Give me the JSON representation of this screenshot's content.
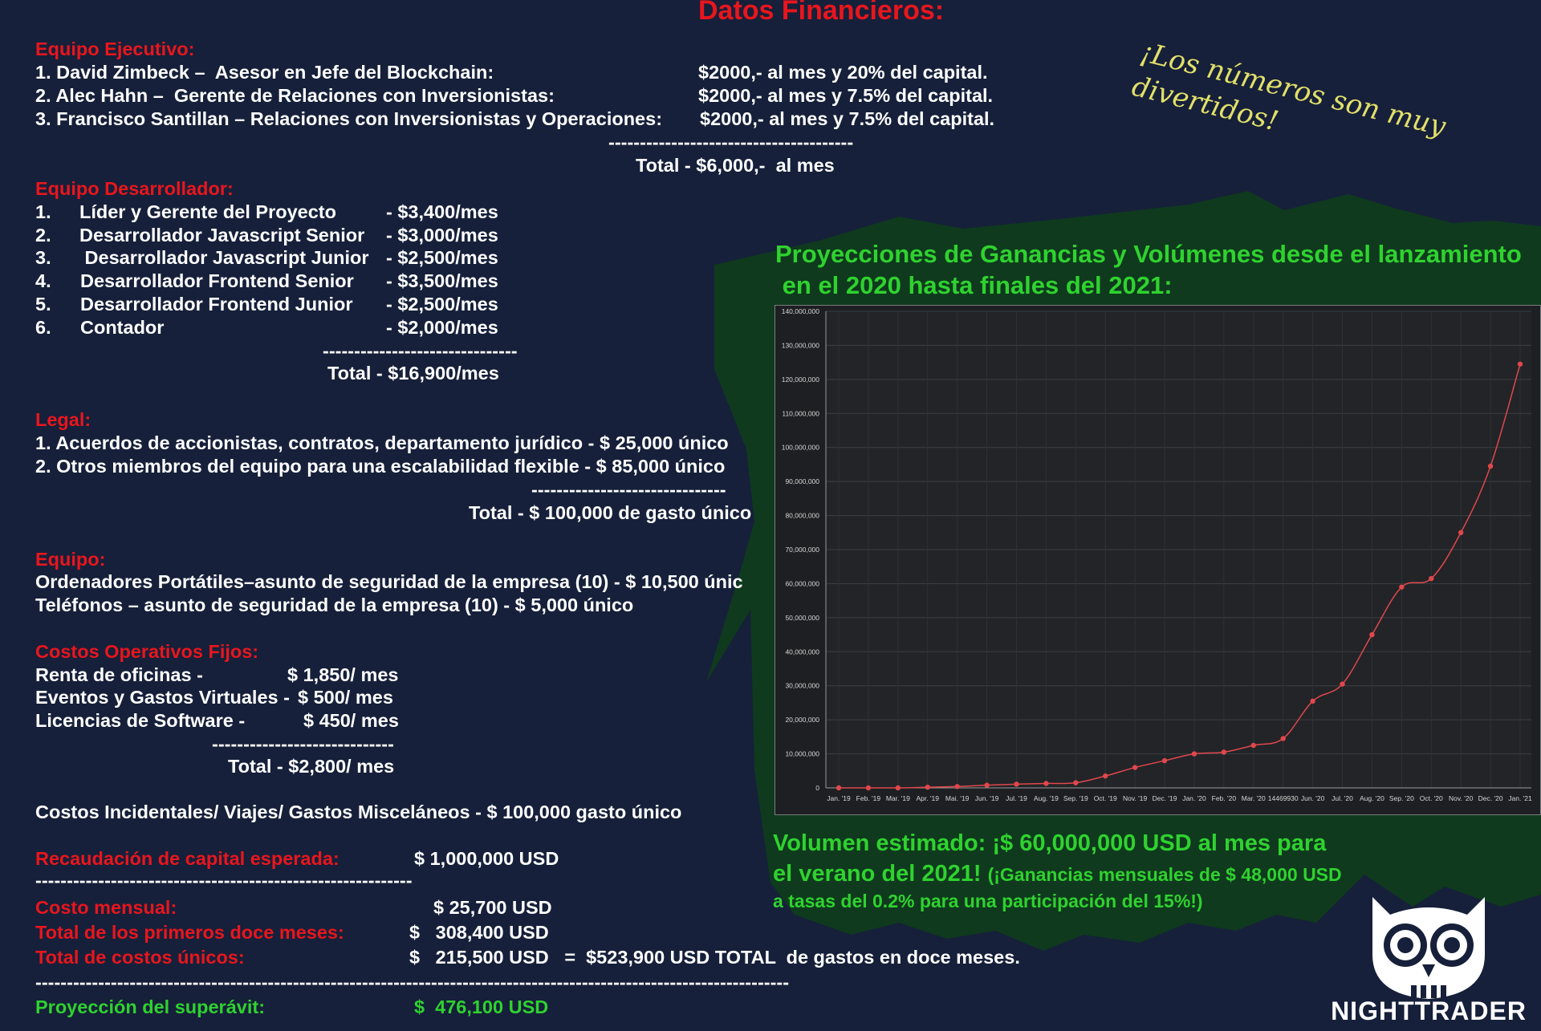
{
  "title": "Datos Financieros:",
  "note": "¡Los números son muy divertidos!",
  "sections": {
    "ejecutivo": {
      "heading": "Equipo Ejecutivo:",
      "rows": [
        {
          "label": "1. David Zimbeck –  Asesor en Jefe del Blockchain:",
          "value": "$2000,- al mes y 20% del capital."
        },
        {
          "label": "2. Alec Hahn –  Gerente de Relaciones con Inversionistas:",
          "value": "$2000,- al mes y 7.5% del capital."
        },
        {
          "label": "3. Francisco Santillan – Relaciones con Inversionistas y Operaciones:",
          "value": "$2000,- al mes y 7.5% del capital."
        }
      ],
      "divider": "---------------------------------------",
      "total": "Total - $6,000,-  al mes"
    },
    "desarrollador": {
      "heading": "Equipo Desarrollador:",
      "rows": [
        {
          "num": "1.",
          "label": "Líder y Gerente del Proyecto",
          "value": "- $3,400/mes"
        },
        {
          "num": "2.",
          "label": "Desarrollador Javascript Senior",
          "value": "- $3,000/mes"
        },
        {
          "num": "3.",
          "label": " Desarrollador Javascript Junior",
          "value": "- $2,500/mes"
        },
        {
          "num": "4.",
          "label": "Desarrollador Frontend Senior",
          "value": "- $3,500/mes"
        },
        {
          "num": "5.",
          "label": "Desarrollador Frontend Junior",
          "value": "- $2,500/mes"
        },
        {
          "num": "6.",
          "label": "Contador",
          "value": "- $2,000/mes"
        }
      ],
      "divider": "-------------------------------",
      "total": "Total - $16,900/mes"
    },
    "legal": {
      "heading": "Legal:",
      "rows": [
        "1. Acuerdos de accionistas, contratos, departamento jurídico - $ 25,000 único",
        "2. Otros miembros del equipo para una escalabilidad flexible - $ 85,000 único"
      ],
      "divider": "-------------------------------",
      "total": "Total - $ 100,000 de gasto único"
    },
    "equipo": {
      "heading": "Equipo:",
      "rows": [
        "Ordenadores Portátiles–asunto de seguridad de la empresa (10) - $ 10,500 únic",
        "Teléfonos – asunto de seguridad de la empresa (10) - $ 5,000 único"
      ]
    },
    "operativos": {
      "heading": "Costos Operativos Fijos:",
      "rows": [
        {
          "label": "Renta de oficinas -",
          "value": "$ 1,850/ mes"
        },
        {
          "label": "Eventos y Gastos Virtuales -",
          "value": "$ 500/ mes"
        },
        {
          "label": "Licencias de Software -",
          "value": "$ 450/ mes"
        }
      ],
      "divider": "-----------------------------",
      "total": "Total - $2,800/ mes"
    },
    "incidentales": "Costos Incidentales/ Viajes/ Gastos Misceláneos - $ 100,000 gasto único",
    "summary": {
      "recaudacion_label": "Recaudación de capital esperada:",
      "recaudacion_value": "$ 1,000,000 USD",
      "divider1": "------------------------------------------------------------",
      "mensual_label": "Costo mensual:",
      "mensual_value": "$ 25,700 USD",
      "doce_label": "Total de los primeros doce meses:",
      "doce_value": "$   308,400 USD",
      "unicos_label": "Total de costos únicos:",
      "unicos_value": "$   215,500 USD   =  $523,900 USD TOTAL  de gastos en doce meses.",
      "divider2": "------------------------------------------------------------------------------------------------------------------------",
      "superavit_label": "Proyección del superávit:",
      "superavit_value": "$  476,100 USD"
    }
  },
  "chart_heading": [
    "Proyecciones de Ganancias y Volúmenes desde el lanzamiento",
    " en el 2020 hasta finales del 2021:"
  ],
  "volume_text": {
    "line1": "Volumen estimado: ¡$ 60,000,000 USD al mes para",
    "line2a": "el verano del 2021! ",
    "line2b": "(¡Ganancias mensuales de $ 48,000 USD",
    "line3": "a tasas del 0.2% para una participación del 15%!)"
  },
  "logo_text": "NIGHTTRADER",
  "colors": {
    "background": "#16203a",
    "red": "#e8161d",
    "green": "#2fd22f",
    "shape": "#0f3a1e",
    "line": "#e0474c"
  },
  "chart_data": {
    "type": "line",
    "x": [
      "Jan. '19",
      "Feb. '19",
      "Mar. '19",
      "Apr. '19",
      "Mai. '19",
      "Jun. '19",
      "Jul. '19",
      "Aug. '19",
      "Sep. '19",
      "Oct. '19",
      "Nov. '19",
      "Dec. '19",
      "Jan. '20",
      "Feb. '20",
      "Mar. '20",
      "14469930",
      "Jun. '20",
      "Jul. '20",
      "Aug. '20",
      "Sep. '20",
      "Oct. '20",
      "Nov. '20",
      "Dec. '20",
      "Jan. '21"
    ],
    "values": [
      0,
      0,
      0,
      200000,
      400000,
      800000,
      1100000,
      1300000,
      1500000,
      3500000,
      6000000,
      8000000,
      10000000,
      10500000,
      12500000,
      14500000,
      25500000,
      30500000,
      45000000,
      59000000,
      61500000,
      75000000,
      94500000,
      124500000
    ],
    "ylim": [
      0,
      140000000
    ],
    "yticks": [
      "0",
      "10,000,000",
      "20,000,000",
      "30,000,000",
      "40,000,000",
      "50,000,000",
      "60,000,000",
      "70,000,000",
      "80,000,000",
      "90,000,000",
      "100,000,000",
      "110,000,000",
      "120,000,000",
      "130,000,000",
      "140,000,000"
    ],
    "grid": true
  }
}
